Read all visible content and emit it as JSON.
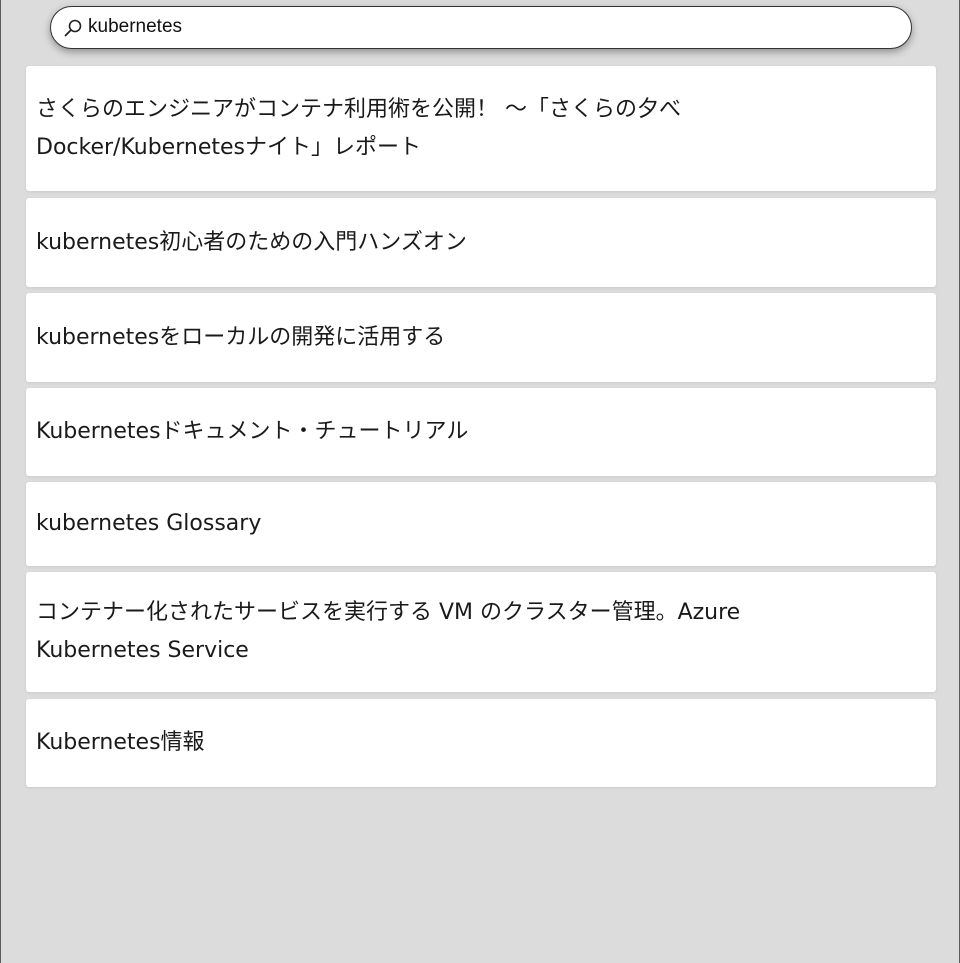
{
  "search": {
    "value": "kubernetes",
    "icon": "search-icon"
  },
  "results": [
    {
      "title": "さくらのエンジニアがコンテナ利用術を公開！ ～「さくらの夕べ Docker/Kubernetesナイト」レポート"
    },
    {
      "title": "kubernetes初心者のための入門ハンズオン"
    },
    {
      "title": "kubernetesをローカルの開発に活用する"
    },
    {
      "title": "Kubernetesドキュメント・チュートリアル"
    },
    {
      "title": "kubernetes Glossary"
    },
    {
      "title": "コンテナー化されたサービスを実行する VM のクラスター管理。Azure Kubernetes Service"
    },
    {
      "title": "Kubernetes情報"
    }
  ],
  "colors": {
    "background": "#dcdcdc",
    "card": "#ffffff",
    "text": "#1a1a1a"
  }
}
